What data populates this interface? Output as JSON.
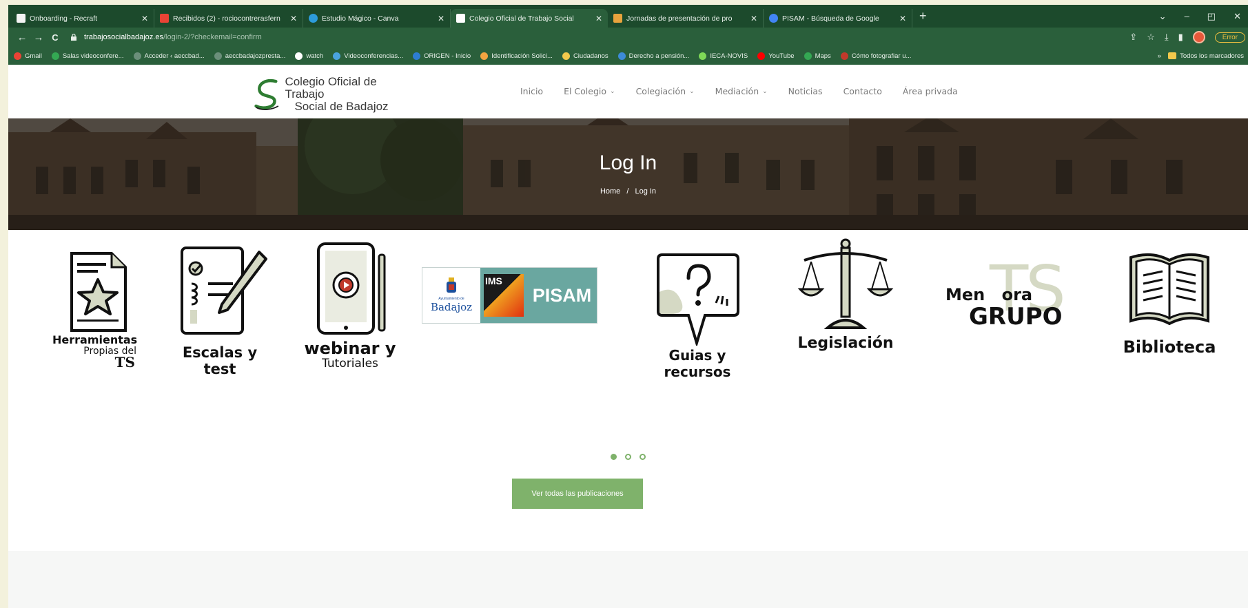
{
  "browser": {
    "tabs": [
      {
        "title": "Onboarding - Recraft",
        "favicon_color": "#f4f4f4",
        "active": false
      },
      {
        "title": "Recibidos (2) - rociocontrerasfern",
        "favicon_color": "#ea4335",
        "active": false
      },
      {
        "title": "Estudio Mágico - Canva",
        "favicon_color": "#2d9cdb",
        "active": false
      },
      {
        "title": "Colegio Oficial de Trabajo Social",
        "favicon_color": "#4a9e5c",
        "active": true
      },
      {
        "title": "Jornadas de presentación de pro",
        "favicon_color": "#e8a33d",
        "active": false
      },
      {
        "title": "PISAM - Búsqueda de Google",
        "favicon_color": "#4285f4",
        "active": false
      }
    ],
    "new_tab": "+",
    "window_controls": {
      "tabs_list": "⌄",
      "minimize": "–",
      "maximize": "◰",
      "close": "✕"
    },
    "nav": {
      "back": "←",
      "forward": "→",
      "reload": "C"
    },
    "url": {
      "domain": "trabajosocialbadajoz.es",
      "path": "/login-2/?checkemail=confirm"
    },
    "addr_icons": {
      "share": "⇪",
      "star": "☆",
      "download": "⤓",
      "sidepanel": "▮"
    },
    "error_label": "Error",
    "bookmarks": [
      {
        "label": "Gmail",
        "color": "#ea4335"
      },
      {
        "label": "Salas videoconfere...",
        "color": "#34a853"
      },
      {
        "label": "Acceder ‹ aeccbad...",
        "color": "#6b8f7a"
      },
      {
        "label": "aeccbadajozpresta...",
        "color": "#6b8f7a"
      },
      {
        "label": "watch",
        "color": "#ffffff"
      },
      {
        "label": "Videoconferencias...",
        "color": "#4aa3df"
      },
      {
        "label": "ORIGEN - Inicio",
        "color": "#2d7dd2"
      },
      {
        "label": "Identificación Solici...",
        "color": "#f2a541"
      },
      {
        "label": "Ciudadanos",
        "color": "#f2c94c"
      },
      {
        "label": "Derecho a pensión...",
        "color": "#3d8bd9"
      },
      {
        "label": "IECA-NOVIS",
        "color": "#7ed957"
      },
      {
        "label": "YouTube",
        "color": "#ff0000"
      },
      {
        "label": "Maps",
        "color": "#34a853"
      },
      {
        "label": "Cómo fotografiar u...",
        "color": "#c0392b"
      }
    ],
    "bookmarks_more": "»",
    "all_bookmarks": "Todos los marcadores"
  },
  "site": {
    "logo_line1": "Colegio Oficial de Trabajo",
    "logo_line2": "Social de Badajoz",
    "menu": [
      {
        "label": "Inicio",
        "dropdown": false
      },
      {
        "label": "El Colegio",
        "dropdown": true
      },
      {
        "label": "Colegiación",
        "dropdown": true
      },
      {
        "label": "Mediación",
        "dropdown": true
      },
      {
        "label": "Noticias",
        "dropdown": false
      },
      {
        "label": "Contacto",
        "dropdown": false
      },
      {
        "label": "Área privada",
        "dropdown": false
      }
    ],
    "chevron": "⌄",
    "hero_title": "Log In",
    "breadcrumb_home": "Home",
    "breadcrumb_sep": "/",
    "breadcrumb_current": "Log In",
    "services": {
      "herramientas": {
        "line1": "Herramientas",
        "line2": "Propias del",
        "line3": "TS"
      },
      "escalas": {
        "label": "Escalas y test"
      },
      "webinar": {
        "line1": "webinar y",
        "line2": "Tutoriales"
      },
      "pisam": {
        "city": "Badajoz",
        "council": "Ayuntamiento de",
        "ims": "IMS",
        "label": "PISAM"
      },
      "guias": {
        "label": "Guias y recursos"
      },
      "legislacion": {
        "label": "Legislación"
      },
      "mentora": {
        "line1": "Men",
        "line1b": "ora",
        "line2": "GRUPO",
        "watermark": "TS"
      },
      "biblioteca": {
        "label": "Biblioteca"
      }
    },
    "carousel_active": 1,
    "cta_label": "Ver todas las publicaciones",
    "accent": "#7fb26b"
  }
}
